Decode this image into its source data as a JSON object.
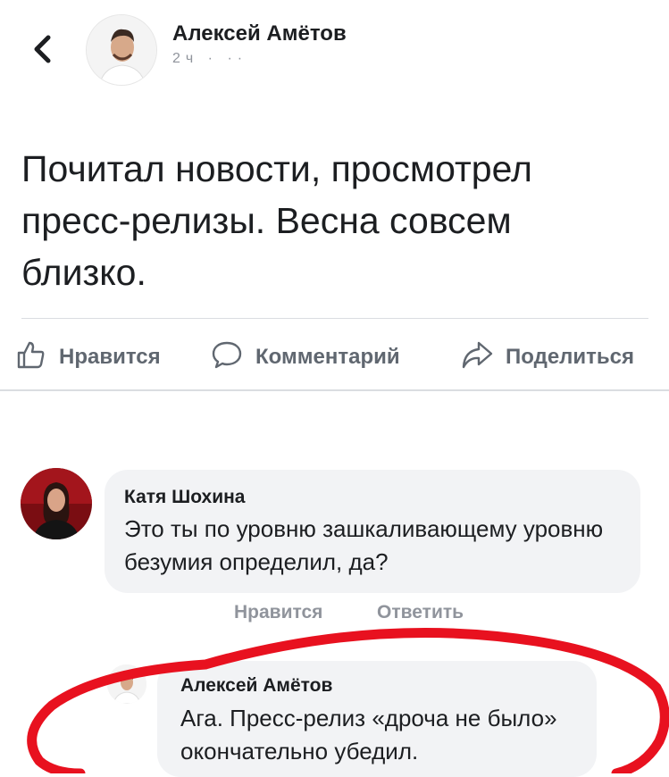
{
  "header": {
    "author_name": "Алексей Амётов",
    "meta": "2ч · ··"
  },
  "post": {
    "text": "Почитал новости, просмотрел пресс-релизы. Весна совсем близко."
  },
  "actions": {
    "like": "Нравится",
    "comment": "Комментарий",
    "share": "Поделиться"
  },
  "comments": [
    {
      "author": "Катя Шохина",
      "text": "Это ты по уровню зашкаливающему уровню безумия определил, да?",
      "like_label": "Нравится",
      "reply_label": "Ответить"
    },
    {
      "author": "Алексей Амётов",
      "text": "Ага. Пресс-релиз «дроча не было» окончательно убедил."
    }
  ],
  "colors": {
    "text": "#1c1e21",
    "secondary": "#606770",
    "muted": "#90949c",
    "bubble": "#f2f3f5",
    "highlight": "#e8111f"
  }
}
